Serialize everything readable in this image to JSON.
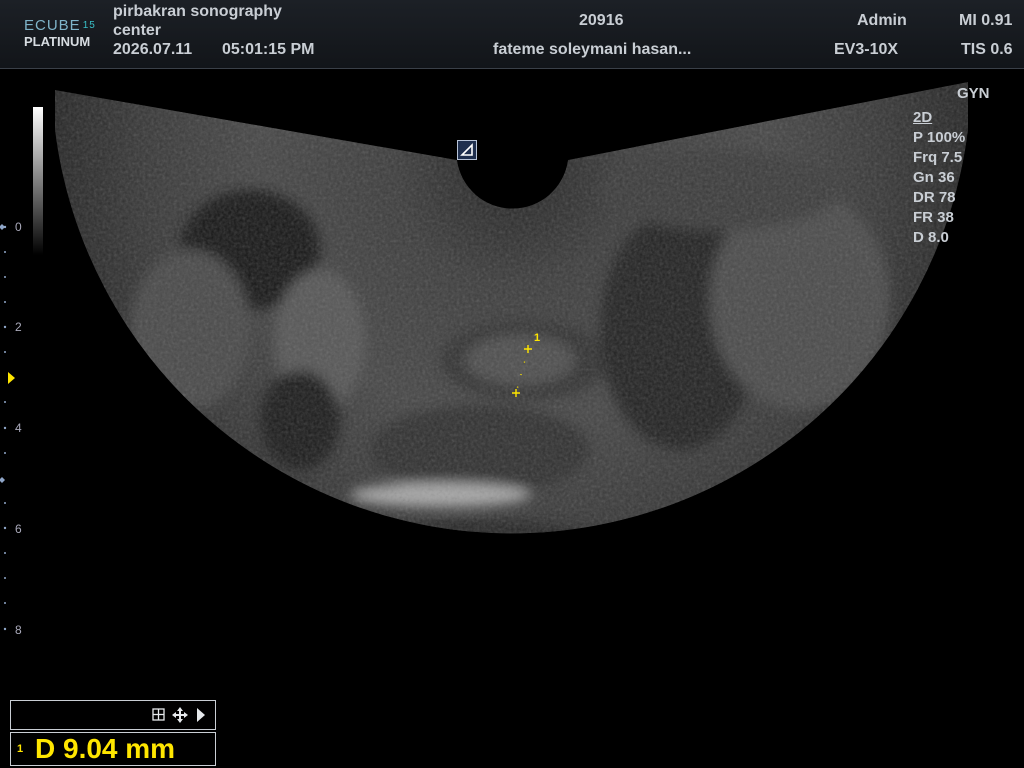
{
  "header": {
    "logo_line1": "ECUBE",
    "logo_model": "15",
    "logo_line2": "PLATINUM",
    "center_name_line1": "pirbakran sonography",
    "center_name_line2": "center",
    "date": "2026.07.11",
    "time": "05:01:15  PM",
    "patient_id": "20916",
    "patient_name": "fateme soleymani hasan...",
    "operator": "Admin",
    "probe": "EV3-10X",
    "mi": "MI 0.91",
    "tis": "TIS 0.6"
  },
  "preset": "GYN",
  "imaging_params": {
    "mode": "2D",
    "power": "P 100%",
    "frequency": "Frq 7.5",
    "gain": "Gn 36",
    "dynamic_range": "DR 78",
    "frame_rate": "FR 38",
    "depth": "D 8.0"
  },
  "depth_scale": [
    "0",
    "2",
    "4",
    "6",
    "8"
  ],
  "measurement": {
    "index": "1",
    "text": "D  9.04 mm",
    "caliper_label": "1"
  },
  "controls": {
    "icons": [
      "grid-icon",
      "move-icon",
      "play-icon"
    ]
  },
  "colors": {
    "measurement": "#ffe600",
    "header_bg": "#1c2026"
  }
}
